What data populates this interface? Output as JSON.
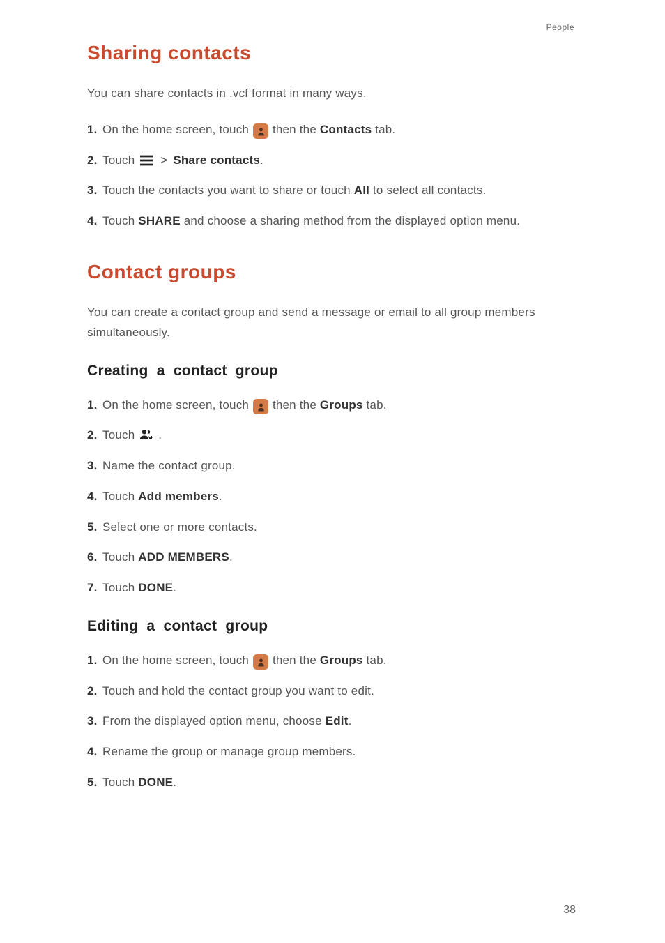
{
  "header": {
    "section_label": "People"
  },
  "section1": {
    "title": "Sharing contacts",
    "intro": "You can share contacts in .vcf format in many ways.",
    "steps": [
      {
        "pre": "On the home screen, touch ",
        "icon": "app",
        "post": "then the ",
        "bold": "Contacts",
        "tail": " tab."
      },
      {
        "pre": "Touch ",
        "icon": "menu",
        "gt": ">",
        "bold": "Share contacts",
        "tail": "."
      },
      {
        "pre": "Touch the contacts you want to share or touch ",
        "bold": "All",
        "tail": " to select all contacts."
      },
      {
        "pre": "Touch ",
        "bold": "SHARE",
        "tail": " and choose a sharing method from the displayed option menu."
      }
    ]
  },
  "section2": {
    "title": "Contact groups",
    "intro": "You can create a contact group and send a message or email to all group members simultaneously.",
    "sub1": {
      "title": "Creating a contact group",
      "steps": [
        {
          "pre": "On the home screen, touch ",
          "icon": "app",
          "post": "then the ",
          "bold": "Groups",
          "tail": " tab."
        },
        {
          "pre": "Touch ",
          "icon": "group-add",
          "tail": "."
        },
        {
          "pre": "Name the contact group."
        },
        {
          "pre": "Touch ",
          "bold": "Add members",
          "tail": "."
        },
        {
          "pre": "Select one or more contacts."
        },
        {
          "pre": "Touch ",
          "bold": "ADD MEMBERS",
          "tail": "."
        },
        {
          "pre": "Touch ",
          "bold": "DONE",
          "tail": "."
        }
      ]
    },
    "sub2": {
      "title": "Editing a contact group",
      "steps": [
        {
          "pre": "On the home screen, touch ",
          "icon": "app",
          "post": "then the ",
          "bold": "Groups",
          "tail": " tab."
        },
        {
          "pre": "Touch and hold the contact group you want to edit."
        },
        {
          "pre": "From the displayed option menu, choose ",
          "bold": "Edit",
          "tail": "."
        },
        {
          "pre": "Rename the group or manage group members."
        },
        {
          "pre": "Touch ",
          "bold": "DONE",
          "tail": "."
        }
      ]
    }
  },
  "page_number": "38"
}
